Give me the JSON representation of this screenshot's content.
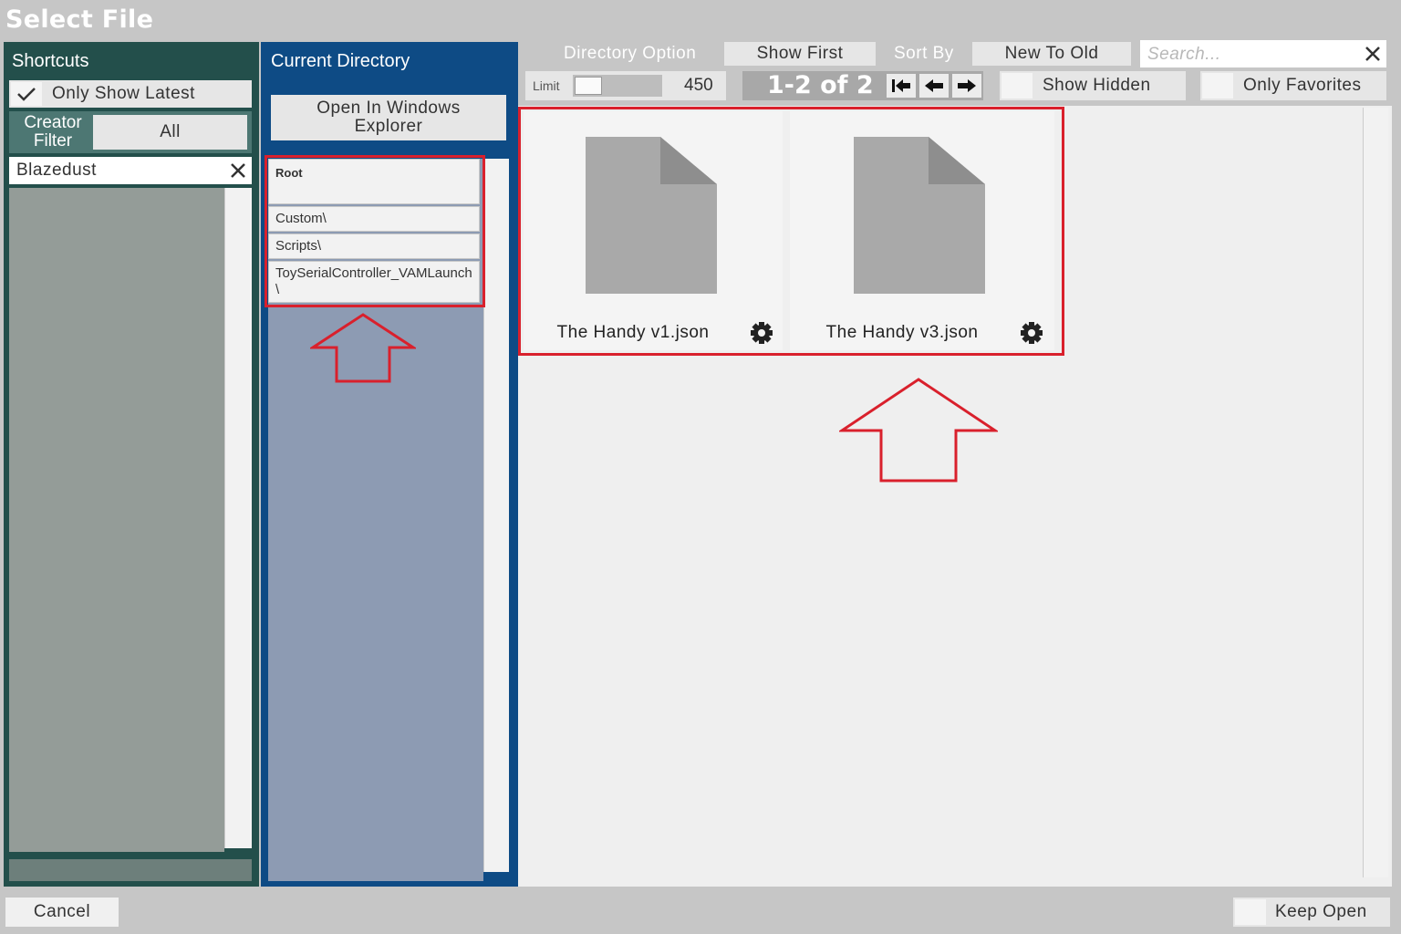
{
  "window": {
    "title": "Select File"
  },
  "shortcuts": {
    "header": "Shortcuts",
    "only_show_latest": "Only Show Latest",
    "creator_filter_label": "Creator\nFilter",
    "creator_filter_value": "All",
    "creator_input_value": "Blazedust"
  },
  "current_directory": {
    "header": "Current Directory",
    "open_explorer": "Open In Windows Explorer",
    "items": [
      "Root",
      "Custom\\",
      "Scripts\\",
      "ToySerialController_VAMLaunch\\"
    ]
  },
  "toolbar": {
    "directory_option": "Directory Option",
    "show_first": "Show First",
    "sort_by": "Sort By",
    "sort_value": "New To Old",
    "search_placeholder": "Search...",
    "limit_label": "Limit",
    "limit_value": "450",
    "page_info": "1-2 of 2",
    "show_hidden": "Show Hidden",
    "only_favorites": "Only Favorites"
  },
  "files": [
    {
      "name": "The Handy v1.json"
    },
    {
      "name": "The Handy v3.json"
    }
  ],
  "footer": {
    "cancel": "Cancel",
    "keep_open": "Keep Open"
  },
  "colors": {
    "shortcuts_bg": "#234f4b",
    "curdir_bg": "#0e4b85",
    "highlight": "#d9202c"
  }
}
